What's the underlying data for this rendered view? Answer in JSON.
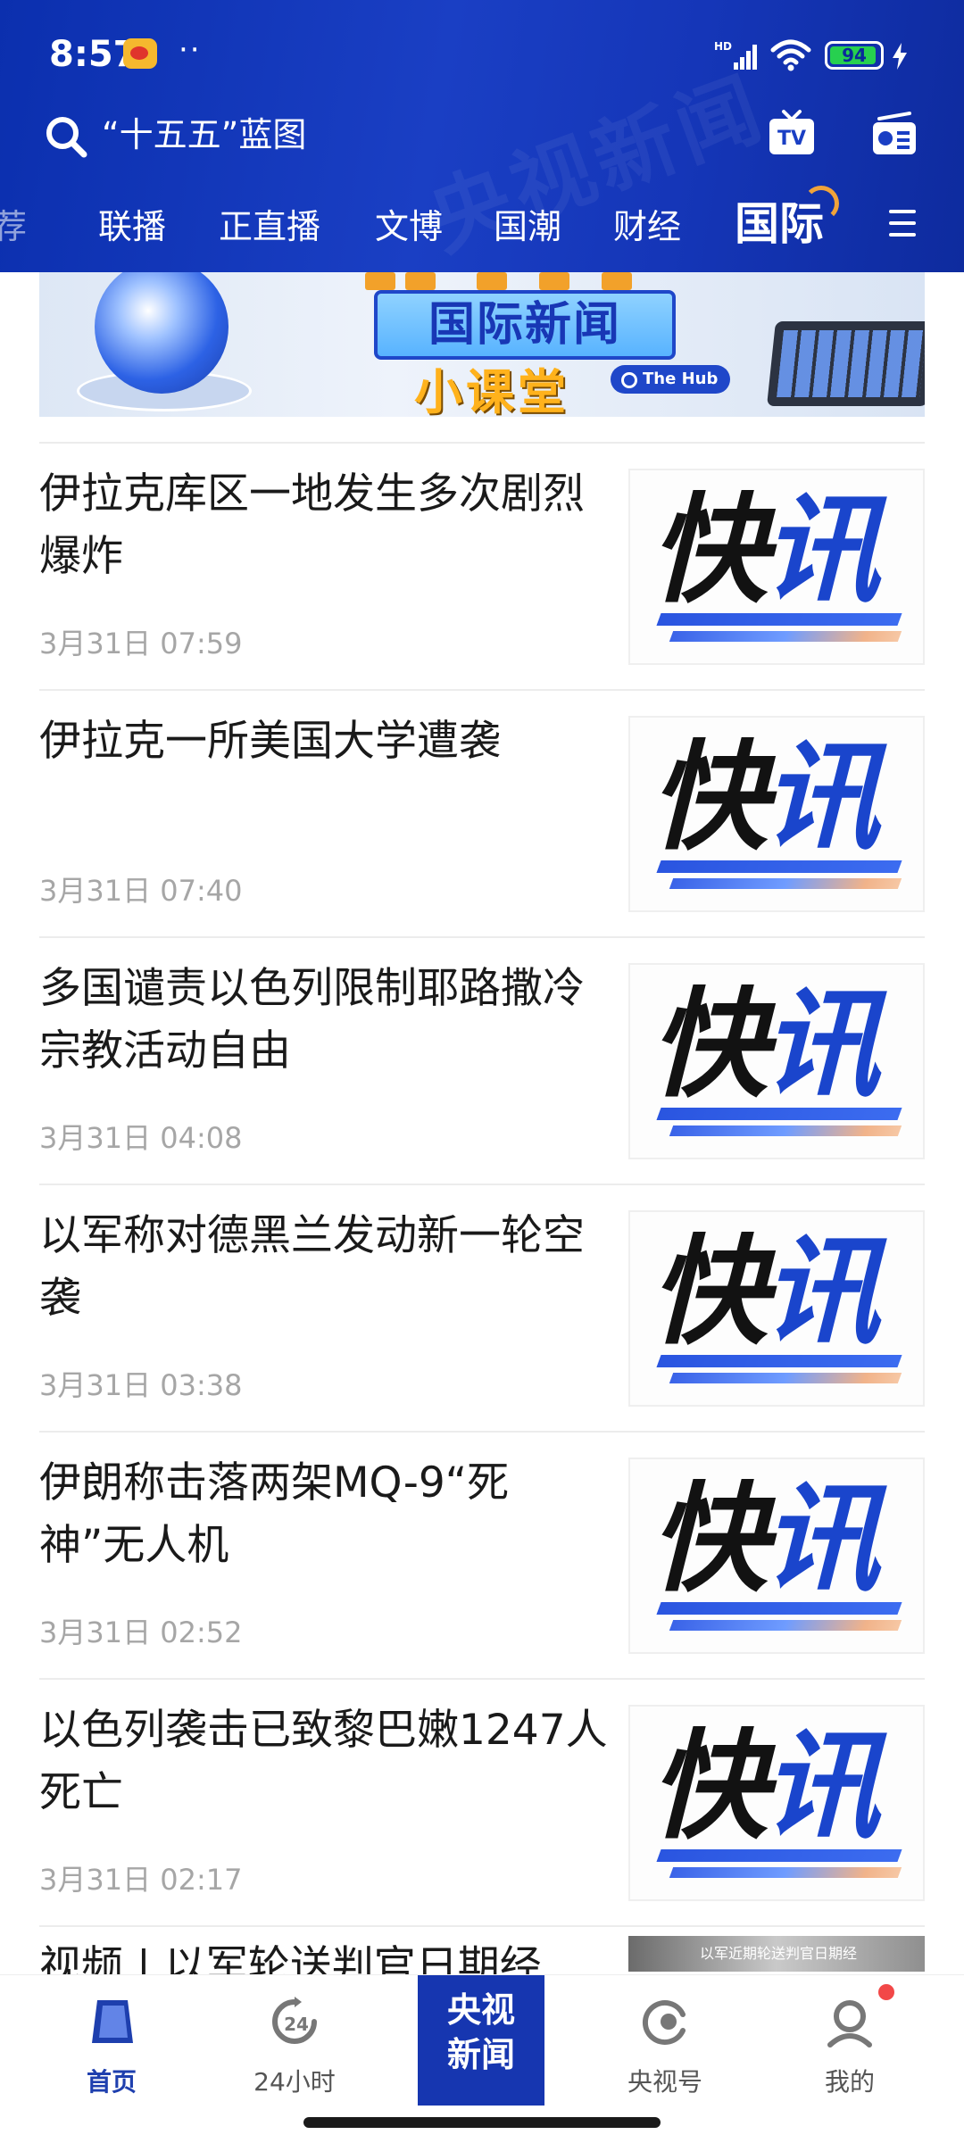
{
  "status_bar": {
    "time": "8:57",
    "dots": "··",
    "network": "HD",
    "battery_level": 94,
    "battery_text": "94"
  },
  "search": {
    "text": "“十五五”蓝图"
  },
  "header": {
    "watermark": "央视新闻",
    "icons": [
      "search-icon",
      "tv-icon",
      "radio-icon",
      "menu-icon"
    ]
  },
  "tabs": [
    {
      "label": "荐",
      "active": false
    },
    {
      "label": "联播",
      "active": false
    },
    {
      "label": "正直播",
      "active": false
    },
    {
      "label": "文博",
      "active": false
    },
    {
      "label": "国潮",
      "active": false
    },
    {
      "label": "财经",
      "active": false
    },
    {
      "label": "国际",
      "active": true
    }
  ],
  "banner": {
    "title": "国际新闻",
    "subtitle": "小课堂",
    "tag": "The Hub"
  },
  "thumb": {
    "main": "快",
    "accent": "讯"
  },
  "news": [
    {
      "title": "伊拉克库区一地发生多次剧烈爆炸",
      "time": "3月31日 07:59"
    },
    {
      "title": "伊拉克一所美国大学遭袭",
      "time": "3月31日 07:40"
    },
    {
      "title": "多国谴责以色列限制耶路撒冷宗教活动自由",
      "time": "3月31日 04:08"
    },
    {
      "title": "以军称对德黑兰发动新一轮空袭",
      "time": "3月31日 03:38"
    },
    {
      "title": "伊朗称击落两架MQ-9“死神”无人机",
      "time": "3月31日 02:52"
    },
    {
      "title": "以色列袭击已致黎巴嫩1247人死亡",
      "time": "3月31日 02:17"
    },
    {
      "title": "视频 | 以军轮送判官日期经",
      "time": ""
    }
  ],
  "partial_thumb_caption": "以军近期轮送判官日期经",
  "bottom_nav": [
    {
      "label": "首页",
      "active": true
    },
    {
      "label": "24小时",
      "active": false
    },
    {
      "label": "央视新闻",
      "active": false
    },
    {
      "label": "央视号",
      "active": false
    },
    {
      "label": "我的",
      "active": false
    }
  ],
  "colors": {
    "header_blue": "#1536b8",
    "accent_blue": "#1a45cc",
    "nav_active": "#1e3fae",
    "time_gray": "#a6a6a6",
    "notif_red": "#f24848",
    "battery_green": "#27d04f"
  }
}
